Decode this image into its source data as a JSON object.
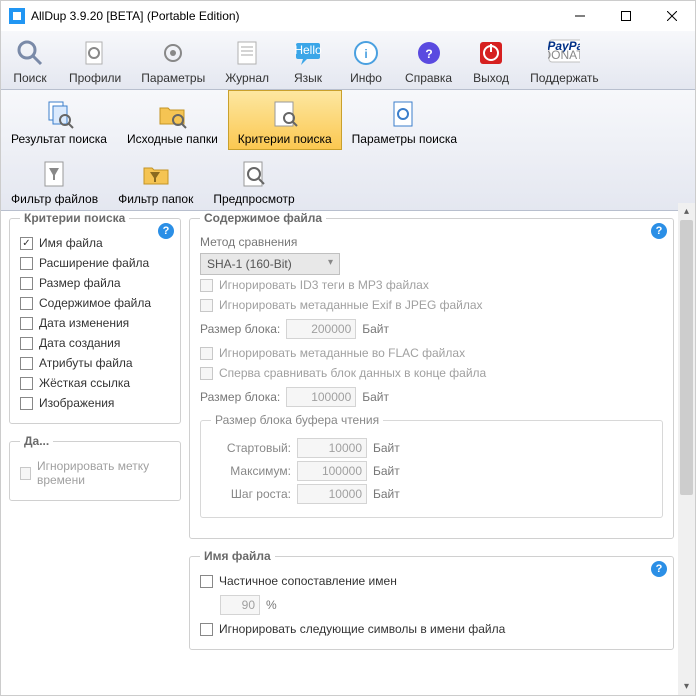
{
  "window": {
    "title": "AllDup 3.9.20 [BETA] (Portable Edition)"
  },
  "toolbar1": {
    "search": "Поиск",
    "profiles": "Профили",
    "params": "Параметры",
    "log": "Журнал",
    "lang": "Язык",
    "info": "Инфо",
    "help": "Справка",
    "exit": "Выход",
    "donate": "Поддержать"
  },
  "toolbar2": {
    "results": "Результат поиска",
    "sources": "Исходные папки",
    "criteria": "Критерии поиска",
    "searchparams": "Параметры поиска",
    "filefilter": "Фильтр файлов",
    "folderfilter": "Фильтр папок",
    "preview": "Предпросмотр"
  },
  "criteria": {
    "legend": "Критерии поиска",
    "items": {
      "name": "Имя файла",
      "ext": "Расширение файла",
      "size": "Размер файла",
      "content": "Содержимое файла",
      "mdate": "Дата изменения",
      "cdate": "Дата создания",
      "attrs": "Атрибуты файла",
      "hardlink": "Жёсткая ссылка",
      "images": "Изображения"
    }
  },
  "dates": {
    "legend": "Да...",
    "ignore_ts": "Игнорировать метку времени"
  },
  "content": {
    "legend": "Содержимое файла",
    "method_label": "Метод сравнения",
    "method_value": "SHA-1 (160-Bit)",
    "ignore_id3": "Игнорировать ID3 теги в MP3 файлах",
    "ignore_exif": "Игнорировать метаданные Exif в JPEG файлах",
    "block_size_label": "Размер блока:",
    "block_size_value": "200000",
    "unit": "Байт",
    "ignore_flac": "Игнорировать метаданные во FLAC файлах",
    "compare_end": "Сперва сравнивать блок данных в конце файла",
    "block_size2_value": "100000",
    "buffer_legend": "Размер блока буфера чтения",
    "buffer": {
      "start_label": "Стартовый:",
      "start_value": "10000",
      "max_label": "Максимум:",
      "max_value": "100000",
      "step_label": "Шаг роста:",
      "step_value": "10000"
    }
  },
  "filename": {
    "legend": "Имя файла",
    "partial": "Частичное сопоставление имен",
    "percent_value": "90",
    "percent_unit": "%",
    "ignore_sym": "Игнорировать следующие символы в имени файла"
  }
}
